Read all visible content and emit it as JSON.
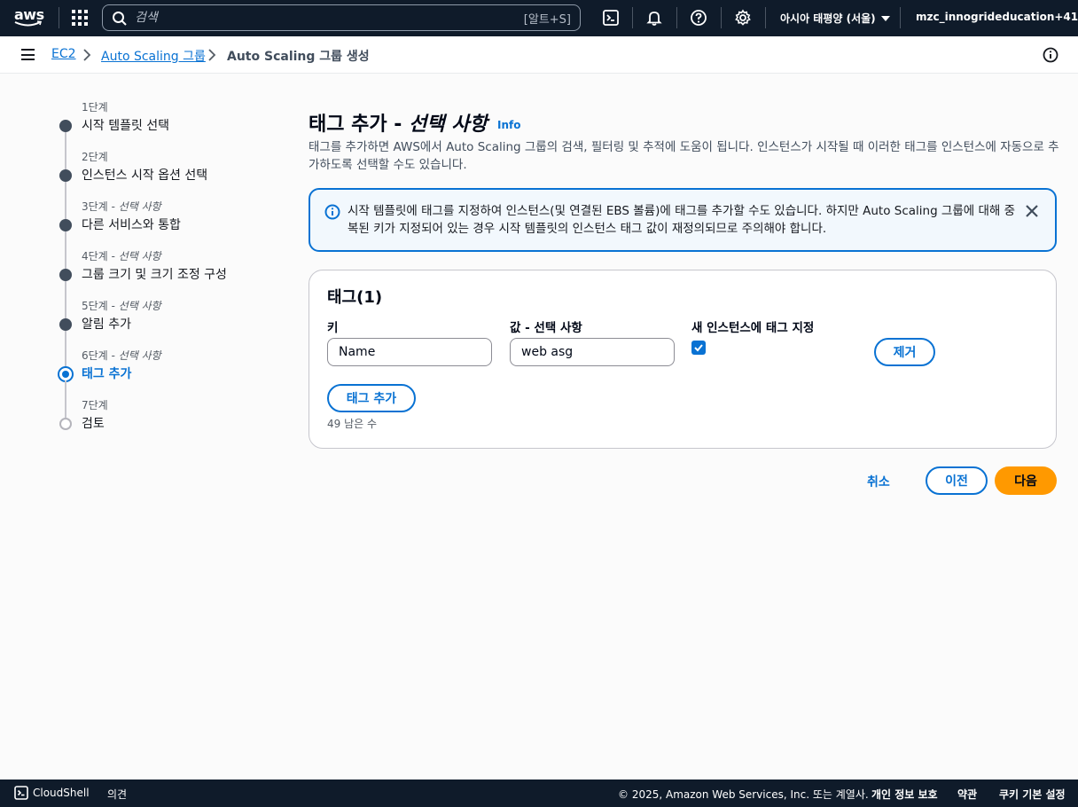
{
  "topnav": {
    "logo_text": "aws",
    "search_placeholder": "검색",
    "search_shortcut": "[알트+S]",
    "region": "아시아 태평양 (서울)",
    "account": "mzc_innogrideducation+41"
  },
  "breadcrumb": {
    "items": [
      "EC2",
      "Auto Scaling 그룹",
      "Auto Scaling 그룹 생성"
    ]
  },
  "steps": [
    {
      "num": "1단계",
      "optional": "",
      "title": "시작 템플릿 선택"
    },
    {
      "num": "2단계",
      "optional": "",
      "title": "인스턴스 시작 옵션 선택"
    },
    {
      "num": "3단계",
      "optional": " - 선택 사항",
      "title": "다른 서비스와 통합"
    },
    {
      "num": "4단계",
      "optional": " - 선택 사항",
      "title": "그룹 크기 및 크기 조정 구성"
    },
    {
      "num": "5단계",
      "optional": " - 선택 사항",
      "title": "알림 추가"
    },
    {
      "num": "6단계",
      "optional": " - 선택 사항",
      "title": "태그 추가"
    },
    {
      "num": "7단계",
      "optional": "",
      "title": "검토"
    }
  ],
  "main": {
    "title_prefix": "태그 추가 - ",
    "title_italic": "선택 사항",
    "info": "Info",
    "description": "태그를 추가하면 AWS에서 Auto Scaling 그룹의 검색, 필터링 및 추적에 도움이 됩니다. 인스턴스가 시작될 때 이러한 태그를 인스턴스에 자동으로 추가하도록 선택할 수도 있습니다.",
    "alert": "시작 템플릿에 태그를 지정하여 인스턴스(및 연결된 EBS 볼륨)에 태그를 추가할 수도 있습니다. 하지만 Auto Scaling 그룹에 대해 중복된 키가 지정되어 있는 경우 시작 템플릿의 인스턴스 태그 값이 재정의되므로 주의해야 합니다."
  },
  "tags": {
    "title": "태그(1)",
    "key_label": "키",
    "value_label": "값 - 선택 사항",
    "propagate_label": "새 인스턴스에 태그 지정",
    "key_value": "Name",
    "value_value": "web asg",
    "propagate_checked": true,
    "remove_label": "제거",
    "add_label": "태그 추가",
    "remaining": "49 남은 수"
  },
  "actions": {
    "cancel": "취소",
    "previous": "이전",
    "next": "다음"
  },
  "footer": {
    "cloudshell": "CloudShell",
    "feedback": "의견",
    "copyright": "© 2025, Amazon Web Services, Inc. 또는 계열사.",
    "privacy": "개인 정보 보호",
    "terms": "약관",
    "cookies": "쿠키 기본 설정"
  }
}
